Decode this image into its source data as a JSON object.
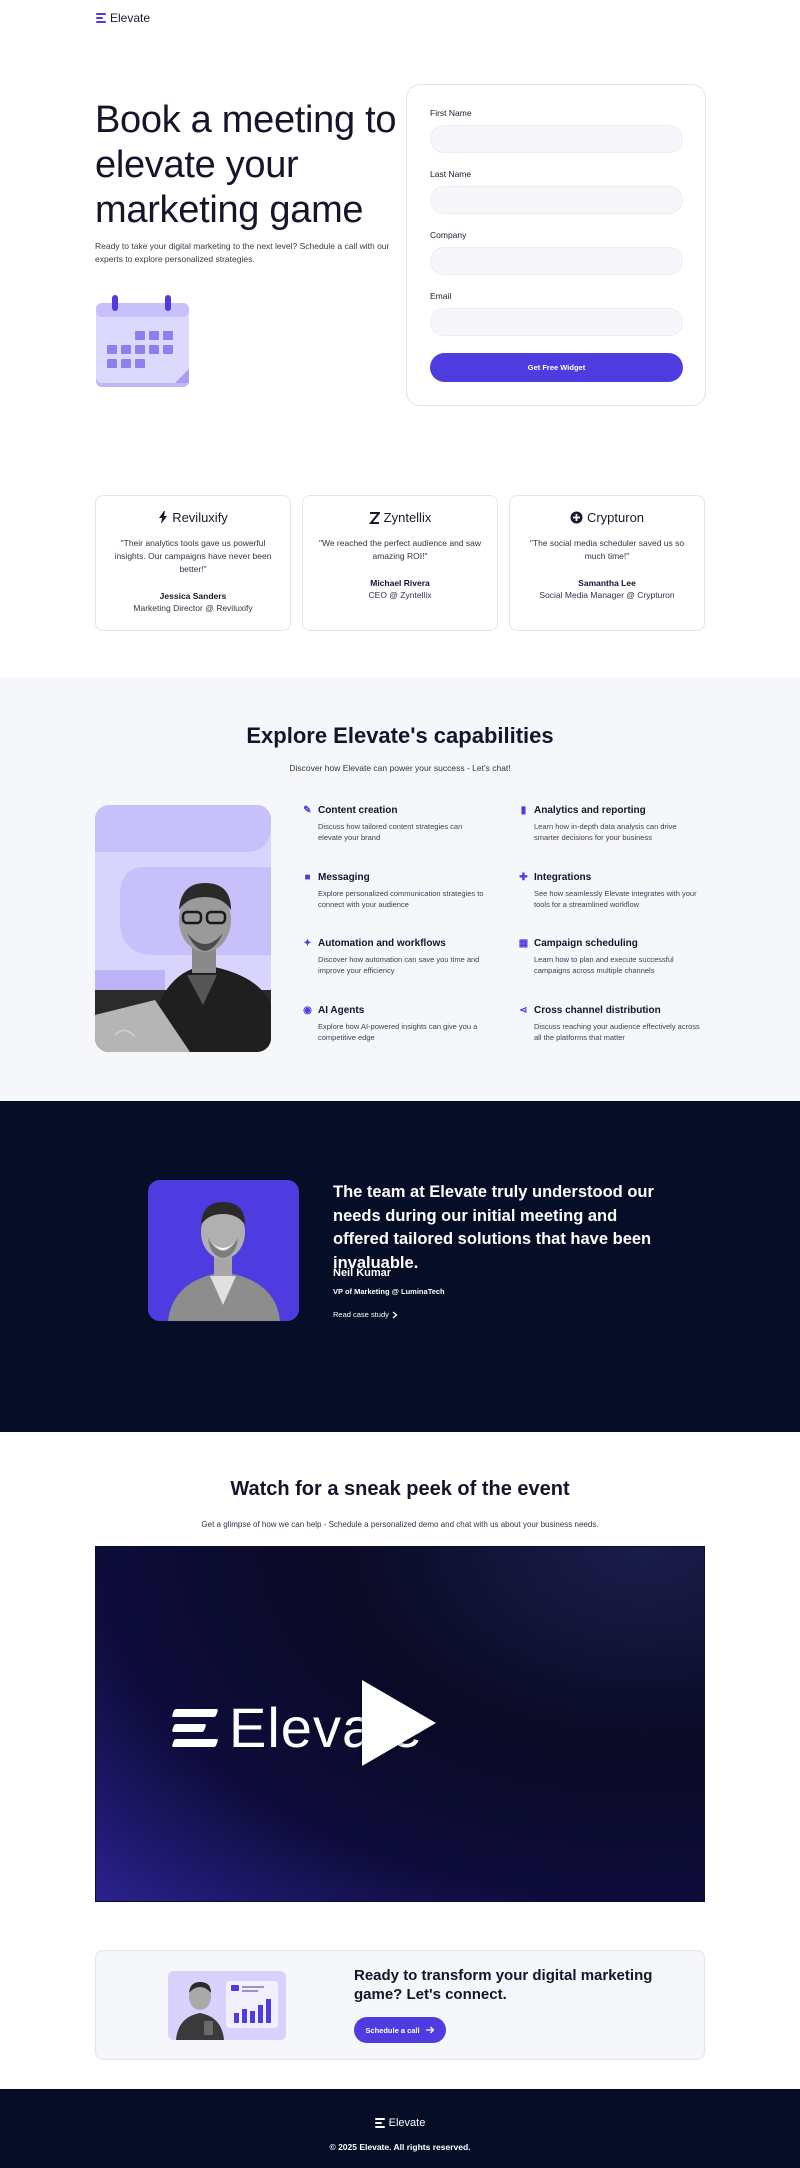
{
  "header": {
    "logo_text": "Elevate",
    "logo_icon": "elevate-logo-icon"
  },
  "hero": {
    "title": "Book a meeting to elevate your marketing game",
    "subtitle": "Ready to take your digital marketing to the next level? Schedule a call with our experts to explore personalized strategies.",
    "illustration_icon": "calendar-icon"
  },
  "form": {
    "fields": [
      {
        "label": "First Name",
        "value": ""
      },
      {
        "label": "Last Name",
        "value": ""
      },
      {
        "label": "Company",
        "value": ""
      },
      {
        "label": "Email",
        "value": ""
      }
    ],
    "submit_label": "Get Free Widget"
  },
  "testimonials": [
    {
      "brand": "Reviluxify",
      "brand_icon": "lightning-icon",
      "quote": "\"Their analytics tools gave us powerful insights. Our campaigns have never been better!\"",
      "name": "Jessica Sanders",
      "role": "Marketing Director @ Reviluxify"
    },
    {
      "brand": "Zyntellix",
      "brand_icon": "z-logo-icon",
      "quote": "\"We reached the perfect audience and saw amazing ROI!\"",
      "name": "Michael Rivera",
      "role": "CEO @ Zyntellix"
    },
    {
      "brand": "Crypturon",
      "brand_icon": "plus-circle-icon",
      "quote": "\"The social media scheduler saved us so much time!\"",
      "name": "Samantha Lee",
      "role": "Social Media Manager @ Crypturon"
    }
  ],
  "capabilities": {
    "title": "Explore Elevate's capabilities",
    "subtitle": "Discover how Elevate can power your success - Let's chat!",
    "items": [
      {
        "icon": "pen-ruler-icon",
        "title": "Content creation",
        "desc": "Discuss how tailored content strategies can elevate your brand"
      },
      {
        "icon": "bar-chart-icon",
        "title": "Analytics and reporting",
        "desc": "Learn how in-depth data analysis can drive smarter decisions for your business"
      },
      {
        "icon": "message-icon",
        "title": "Messaging",
        "desc": "Explore personalized communication strategies to connect with your audience"
      },
      {
        "icon": "puzzle-icon",
        "title": "Integrations",
        "desc": "See how seamlessly Elevate integrates with your tools for a streamlined workflow"
      },
      {
        "icon": "magic-wand-icon",
        "title": "Automation and workflows",
        "desc": "Discover how automation can save you time and improve your efficiency"
      },
      {
        "icon": "calendar-icon",
        "title": "Campaign scheduling",
        "desc": "Learn how to plan and execute successful campaigns across multiple channels"
      },
      {
        "icon": "robot-icon",
        "title": "AI Agents",
        "desc": "Explore how AI-powered insights can give you a competitive edge"
      },
      {
        "icon": "share-icon",
        "title": "Cross channel distribution",
        "desc": "Discuss reaching your audience effectively across all the platforms that matter"
      }
    ]
  },
  "case_quote": {
    "text": "The team at Elevate truly understood our needs during our initial meeting and offered tailored solutions that have been invaluable.",
    "name": "Neil Kumar",
    "role": "VP of Marketing @ LuminaTech",
    "link_label": "Read case study"
  },
  "video": {
    "title": "Watch for a sneak peek of the event",
    "subtitle": "Get a glimpse of how we can help - Schedule a personalized demo and chat with us about your business needs.",
    "logo_text": "Elevate",
    "play_icon": "play-icon"
  },
  "cta": {
    "title": "Ready to transform your digital marketing game? Let's connect.",
    "button_label": "Schedule a call"
  },
  "footer": {
    "logo_text": "Elevate",
    "copyright": "© 2025 Elevate. All rights reserved."
  },
  "colors": {
    "accent": "#4f3ce0",
    "dark": "#050d27",
    "light_bg": "#f6f7fb"
  }
}
